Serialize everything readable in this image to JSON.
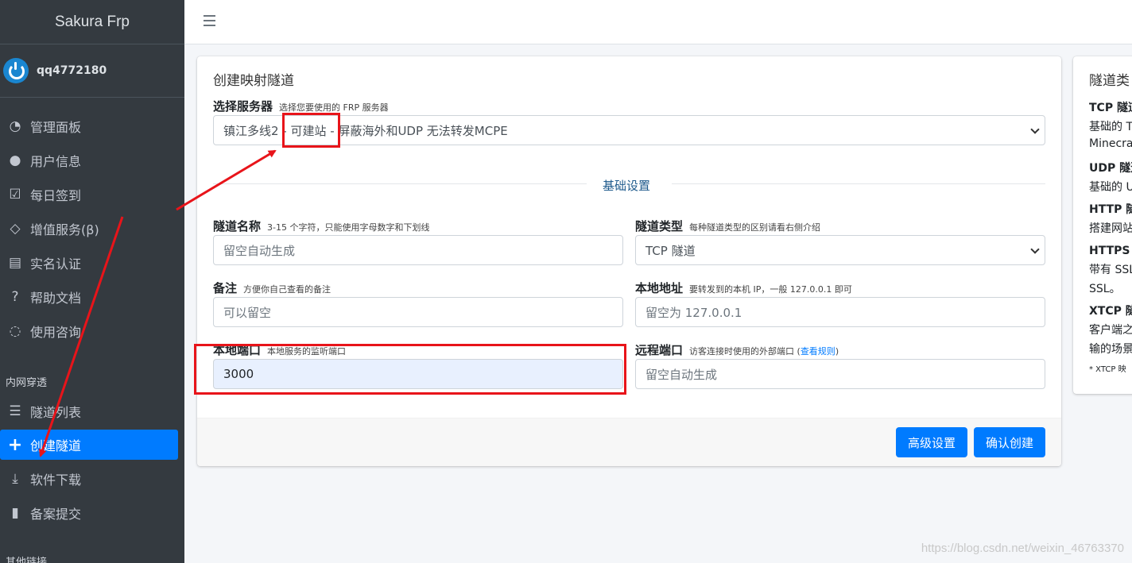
{
  "brand": "Sakura Frp",
  "user": {
    "name": "qq4772180"
  },
  "sidebar": {
    "items": [
      {
        "label": "管理面板",
        "icon": "dashboard-icon",
        "glyph": "◔"
      },
      {
        "label": "用户信息",
        "icon": "user-icon",
        "glyph": "●"
      },
      {
        "label": "每日签到",
        "icon": "checkbox-icon",
        "glyph": "☑"
      },
      {
        "label": "增值服务(β)",
        "icon": "gem-icon",
        "glyph": "◇"
      },
      {
        "label": "实名认证",
        "icon": "id-card-icon",
        "glyph": "▤"
      },
      {
        "label": "帮助文档",
        "icon": "question-icon",
        "glyph": "?"
      },
      {
        "label": "使用咨询",
        "icon": "chat-icon",
        "glyph": "◌"
      }
    ],
    "section1": "内网穿透",
    "section_items": [
      {
        "label": "隧道列表",
        "icon": "list-icon",
        "glyph": "☰"
      },
      {
        "label": "创建隧道",
        "icon": "plus-icon",
        "glyph": "+",
        "active": true
      },
      {
        "label": "软件下载",
        "icon": "download-icon",
        "glyph": "⤓"
      },
      {
        "label": "备案提交",
        "icon": "file-upload-icon",
        "glyph": "▮"
      }
    ],
    "section2": "其他链接"
  },
  "form": {
    "title": "创建映射隧道",
    "server": {
      "label": "选择服务器",
      "hint": "选择您要使用的 FRP 服务器",
      "value": "镇江多线2 - 可建站 - 屏蔽海外和UDP 无法转发MCPE"
    },
    "divider": "基础设置",
    "tunnel_name": {
      "label": "隧道名称",
      "hint": "3-15 个字符，只能使用字母数字和下划线",
      "placeholder": "留空自动生成"
    },
    "tunnel_type": {
      "label": "隧道类型",
      "hint": "每种隧道类型的区别请看右侧介绍",
      "value": "TCP 隧道"
    },
    "note": {
      "label": "备注",
      "hint": "方便你自己查看的备注",
      "placeholder": "可以留空"
    },
    "local_addr": {
      "label": "本地地址",
      "hint": "要转发到的本机 IP，一般 127.0.0.1 即可",
      "placeholder": "留空为 127.0.0.1"
    },
    "local_port": {
      "label": "本地端口",
      "hint": "本地服务的监听端口",
      "value": "3000"
    },
    "remote_port": {
      "label": "远程端口",
      "hint": "访客连接时使用的外部端口 (",
      "link": "查看规则",
      "hint_end": ")",
      "placeholder": "留空自动生成"
    },
    "advanced_label": "高级设置",
    "confirm_label": "确认创建"
  },
  "tunnel_types": {
    "title": "隧道类",
    "lines": [
      {
        "text": "TCP 隧道",
        "bold": true
      },
      {
        "text": "基础的 T"
      },
      {
        "text": "Minecra"
      },
      {
        "text": "UDP 隧道",
        "bold": true
      },
      {
        "text": "基础的 U"
      },
      {
        "text": "HTTP 隧",
        "bold": true
      },
      {
        "text": "搭建网站"
      },
      {
        "text": "HTTPS 隧",
        "bold": true
      },
      {
        "text": "带有 SSL"
      },
      {
        "text": "SSL。"
      },
      {
        "text": "XTCP 隧",
        "bold": true
      },
      {
        "text": "客户端之"
      },
      {
        "text": "输的场景"
      },
      {
        "text": "* XTCP 映",
        "small": true
      }
    ]
  },
  "watermark": "https://blog.csdn.net/weixin_46763370",
  "colors": {
    "sidebar": "#343a40",
    "accent": "#007bff",
    "annotation": "#e8141a"
  }
}
